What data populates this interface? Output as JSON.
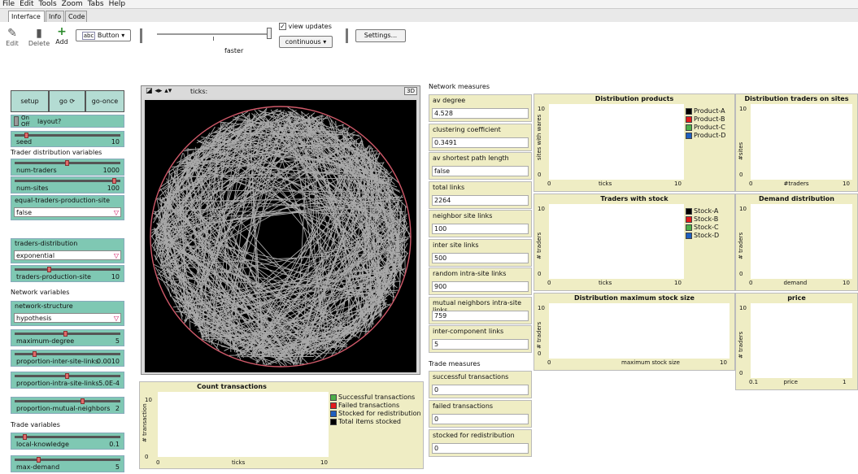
{
  "menu": [
    "File",
    "Edit",
    "Tools",
    "Zoom",
    "Tabs",
    "Help"
  ],
  "tabs": [
    "Interface",
    "Info",
    "Code"
  ],
  "toolbar": {
    "edit": "Edit",
    "delete": "Delete",
    "add": "Add",
    "widget_select": "Button",
    "speed": "faster",
    "view_updates": "view updates",
    "update_mode": "continuous",
    "settings": "Settings..."
  },
  "buttons": {
    "setup": "setup",
    "go": "go",
    "go_once": "go-once"
  },
  "switch": {
    "on": "On",
    "off": "Off",
    "label": "layout?"
  },
  "sliders": {
    "seed": {
      "label": "seed",
      "value": "10",
      "frac": 0.1
    },
    "num_traders": {
      "label": "num-traders",
      "value": "1000",
      "frac": 0.5
    },
    "num_sites": {
      "label": "num-sites",
      "value": "100",
      "frac": 0.97
    },
    "traders_prod": {
      "label": "traders-production-site",
      "value": "10",
      "frac": 0.32
    },
    "max_degree": {
      "label": "maximum-degree",
      "value": "5",
      "frac": 0.48
    },
    "p_inter": {
      "label": "proportion-inter-site-links",
      "value": "0.0010",
      "frac": 0.18
    },
    "p_intra": {
      "label": "proportion-intra-site-links",
      "value": "5.0E-4",
      "frac": 0.5
    },
    "p_mutual": {
      "label": "proportion-mutual-neighbors",
      "value": "2",
      "frac": 0.65
    },
    "local_knowledge": {
      "label": "local-knowledge",
      "value": "0.1",
      "frac": 0.08
    },
    "max_demand": {
      "label": "max-demand",
      "value": "5",
      "frac": 0.22
    }
  },
  "headings": {
    "trader_dist": "Trader distribution variables",
    "network": "Network variables",
    "trade": "Trade variables",
    "network_measures": "Network measures",
    "trade_measures": "Trade measures"
  },
  "choosers": {
    "equal": {
      "label": "equal-traders-production-site",
      "value": "false"
    },
    "dist": {
      "label": "traders-distribution",
      "value": "exponential"
    },
    "structure": {
      "label": "network-structure",
      "value": "hypothesis"
    }
  },
  "view": {
    "ticks_label": "ticks:",
    "threed": "3D"
  },
  "monitors": [
    {
      "label": "av degree",
      "value": "4.528"
    },
    {
      "label": "clustering coefficient",
      "value": "0.3491"
    },
    {
      "label": "av shortest path length",
      "value": "false"
    },
    {
      "label": "total links",
      "value": "2264"
    },
    {
      "label": "neighbor site links",
      "value": "100"
    },
    {
      "label": "inter site links",
      "value": "500"
    },
    {
      "label": "random intra-site links",
      "value": "900"
    },
    {
      "label": "mutual neighbors intra-site links",
      "value": "759"
    },
    {
      "label": "inter-component links",
      "value": "5"
    }
  ],
  "trade_monitors": [
    {
      "label": "successful transactions",
      "value": "0"
    },
    {
      "label": "failed transactions",
      "value": "0"
    },
    {
      "label": "stocked for redistribution",
      "value": "0"
    }
  ],
  "plots": {
    "count": {
      "title": "Count transactions",
      "ylabel": "# transaction",
      "xlabel": "ticks",
      "xmin": "0",
      "xmax": "10",
      "ymin": "0",
      "ymax": "10",
      "legend": [
        {
          "name": "Successful transactions",
          "color": "#4daf4a"
        },
        {
          "name": "Failed transactions",
          "color": "#e41a1c"
        },
        {
          "name": "Stocked for redistribution",
          "color": "#1f5fbf"
        },
        {
          "name": "Total items stocked",
          "color": "#000000"
        }
      ]
    },
    "products": {
      "title": "Distribution products",
      "ylabel": "sites with wares",
      "xlabel": "ticks",
      "xmin": "0",
      "xmax": "10",
      "ymin": "0",
      "ymax": "10",
      "legend": [
        {
          "name": "Product-A",
          "color": "#000000"
        },
        {
          "name": "Product-B",
          "color": "#e41a1c"
        },
        {
          "name": "Product-C",
          "color": "#4daf4a"
        },
        {
          "name": "Product-D",
          "color": "#1f5fbf"
        }
      ]
    },
    "traders_sites": {
      "title": "Distribution traders on sites",
      "ylabel": "#sites",
      "xlabel": "#traders",
      "xmin": "0",
      "xmax": "10",
      "ymin": "0",
      "ymax": "10"
    },
    "stock": {
      "title": "Traders with stock",
      "ylabel": "# traders",
      "xlabel": "ticks",
      "xmin": "0",
      "xmax": "10",
      "ymin": "0",
      "ymax": "10",
      "legend": [
        {
          "name": "Stock-A",
          "color": "#000000"
        },
        {
          "name": "Stock-B",
          "color": "#e41a1c"
        },
        {
          "name": "Stock-C",
          "color": "#4daf4a"
        },
        {
          "name": "Stock-D",
          "color": "#1f5fbf"
        }
      ]
    },
    "demand": {
      "title": "Demand distribution",
      "ylabel": "# traders",
      "xlabel": "demand",
      "xmin": "0",
      "xmax": "10",
      "ymin": "0",
      "ymax": "10"
    },
    "maxstock": {
      "title": "Distribution maximum stock size",
      "ylabel": "# traders",
      "xlabel": "maximum stock size",
      "xmin": "0",
      "xmax": "10",
      "ymin": "0",
      "ymax": "10"
    },
    "price": {
      "title": "price",
      "ylabel": "# traders",
      "xlabel": "price",
      "xmin": "0.1",
      "xmax": "1",
      "ymin": "0",
      "ymax": "10"
    }
  }
}
